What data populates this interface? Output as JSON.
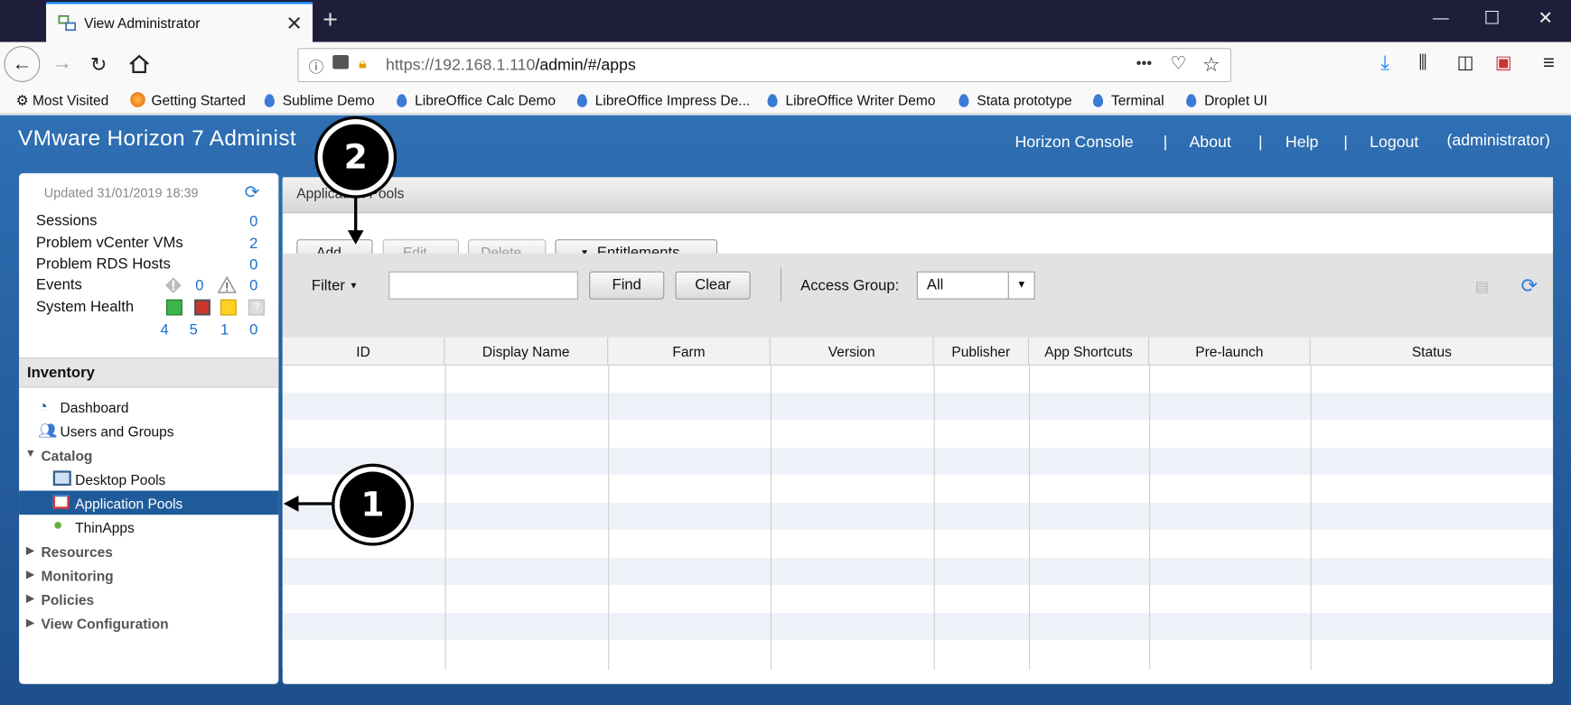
{
  "browser": {
    "tab_title": "View Administrator",
    "tab_close": "✕",
    "new_tab": "+",
    "url_host": "https://192.168.1.110",
    "url_path": "/admin/#/apps",
    "more": "•••",
    "bookmarks": [
      "Most Visited",
      "Getting Started",
      "Sublime Demo",
      "LibreOffice Calc Demo",
      "LibreOffice Impress De...",
      "LibreOffice Writer Demo",
      "Stata prototype",
      "Terminal",
      "Droplet UI"
    ]
  },
  "app": {
    "title": "VMware Horizon 7 Administ",
    "nav": [
      "Horizon Console",
      "About",
      "Help",
      "Logout"
    ],
    "separator": "|",
    "user": "(administrator)"
  },
  "status": {
    "updated": "Updated 31/01/2019 18:39",
    "sessions_label": "Sessions",
    "sessions": "0",
    "vcenter_label": "Problem vCenter VMs",
    "vcenter": "2",
    "rds_label": "Problem RDS Hosts",
    "rds": "0",
    "events_label": "Events",
    "events_warn": "0",
    "events_alert": "0",
    "health_label": "System Health",
    "health_green": "4",
    "health_red": "5",
    "health_yellow": "1",
    "health_grey": "0"
  },
  "inventory": {
    "header": "Inventory",
    "dashboard": "Dashboard",
    "users": "Users and Groups",
    "catalog": "Catalog",
    "desktop_pools": "Desktop Pools",
    "application_pools": "Application Pools",
    "thinapps": "ThinApps",
    "resources": "Resources",
    "monitoring": "Monitoring",
    "policies": "Policies",
    "view_config": "View Configuration"
  },
  "main": {
    "header": "Application Pools",
    "add": "Add...",
    "edit": "Edit...",
    "delete": "Delete...",
    "entitlements": "Entitlements...",
    "filter": "Filter",
    "find": "Find",
    "clear": "Clear",
    "access_group_label": "Access Group:",
    "access_group_value": "All",
    "columns": [
      "ID",
      "Display Name",
      "Farm",
      "Version",
      "Publisher",
      "App Shortcuts",
      "Pre-launch",
      "Status"
    ]
  },
  "callouts": {
    "one": "1",
    "two": "2"
  }
}
